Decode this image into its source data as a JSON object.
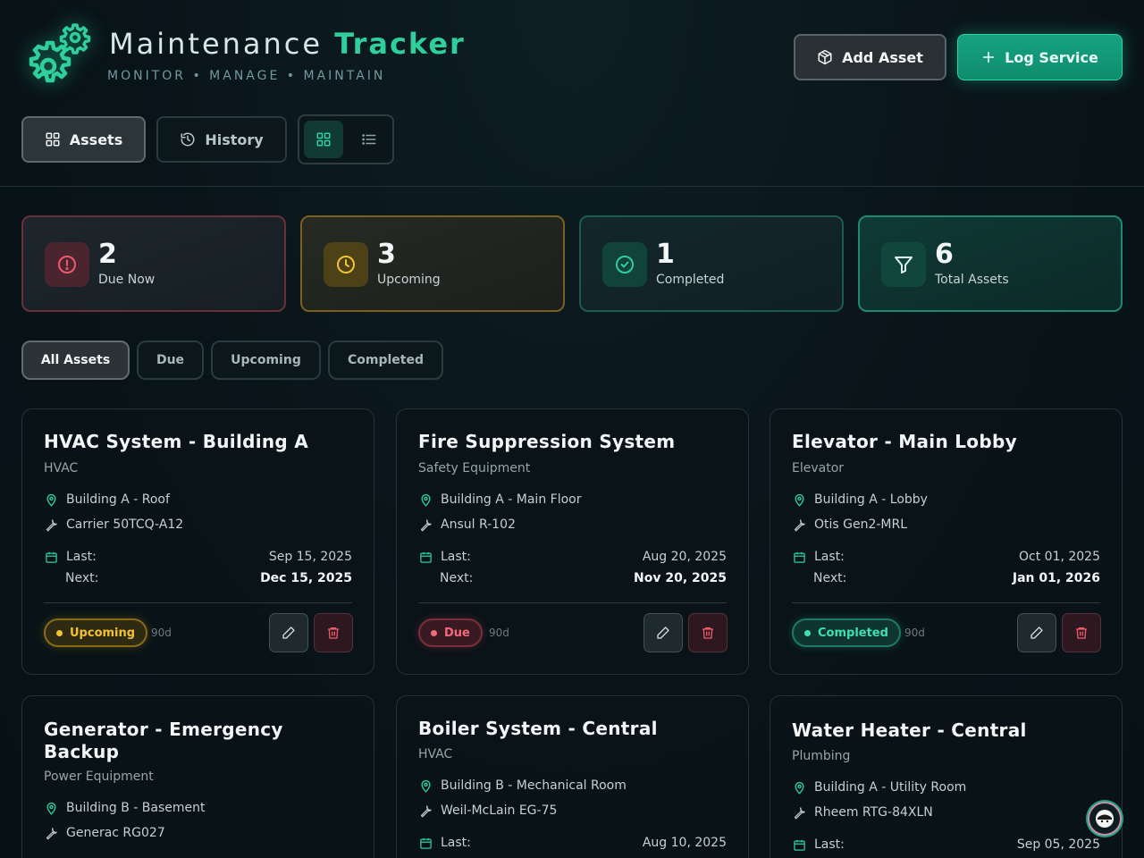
{
  "header": {
    "title_main": "Maintenance",
    "title_accent": "Tracker",
    "subtitle": "MONITOR • MANAGE • MAINTAIN",
    "add_asset_label": "Add Asset",
    "log_service_label": "Log Service",
    "logo_icon": "gear-icon"
  },
  "nav": {
    "assets_label": "Assets",
    "history_label": "History",
    "view_grid_icon": "grid-icon",
    "view_list_icon": "list-icon"
  },
  "stats": [
    {
      "value": "2",
      "label": "Due Now",
      "icon": "alert-circle-icon",
      "color": "#ef5a6a"
    },
    {
      "value": "3",
      "label": "Upcoming",
      "icon": "clock-icon",
      "color": "#f2c233"
    },
    {
      "value": "1",
      "label": "Completed",
      "icon": "check-circle-icon",
      "color": "#2fcf9c"
    },
    {
      "value": "6",
      "label": "Total Assets",
      "icon": "filter-icon",
      "color": "#2fcf9c"
    }
  ],
  "filters": [
    "All Assets",
    "Due",
    "Upcoming",
    "Completed"
  ],
  "labels": {
    "last": "Last:",
    "next": "Next:"
  },
  "assets": [
    {
      "name": "HVAC System - Building A",
      "category": "HVAC",
      "location": "Building A - Roof",
      "model": "Carrier 50TCQ-A12",
      "last": "Sep 15, 2025",
      "next": "Dec 15, 2025",
      "status": "Upcoming",
      "interval": "90d"
    },
    {
      "name": "Fire Suppression System",
      "category": "Safety Equipment",
      "location": "Building A - Main Floor",
      "model": "Ansul R-102",
      "last": "Aug 20, 2025",
      "next": "Nov 20, 2025",
      "status": "Due",
      "interval": "90d"
    },
    {
      "name": "Elevator - Main Lobby",
      "category": "Elevator",
      "location": "Building A - Lobby",
      "model": "Otis Gen2-MRL",
      "last": "Oct 01, 2025",
      "next": "Jan 01, 2026",
      "status": "Completed",
      "interval": "90d"
    },
    {
      "name": "Generator - Emergency Backup",
      "category": "Power Equipment",
      "location": "Building B - Basement",
      "model": "Generac RG027"
    },
    {
      "name": "Boiler System - Central",
      "category": "HVAC",
      "location": "Building B - Mechanical Room",
      "model": "Weil-McLain EG-75",
      "last": "Aug 10, 2025"
    },
    {
      "name": "Water Heater - Central",
      "category": "Plumbing",
      "location": "Building A - Utility Room",
      "model": "Rheem RTG-84XLN",
      "last": "Sep 05, 2025"
    }
  ],
  "colors": {
    "accent": "#2fcf9c",
    "due": "#ef5a6a",
    "upcoming": "#f2c233",
    "completed": "#3fe0b0",
    "background": "#091419"
  }
}
